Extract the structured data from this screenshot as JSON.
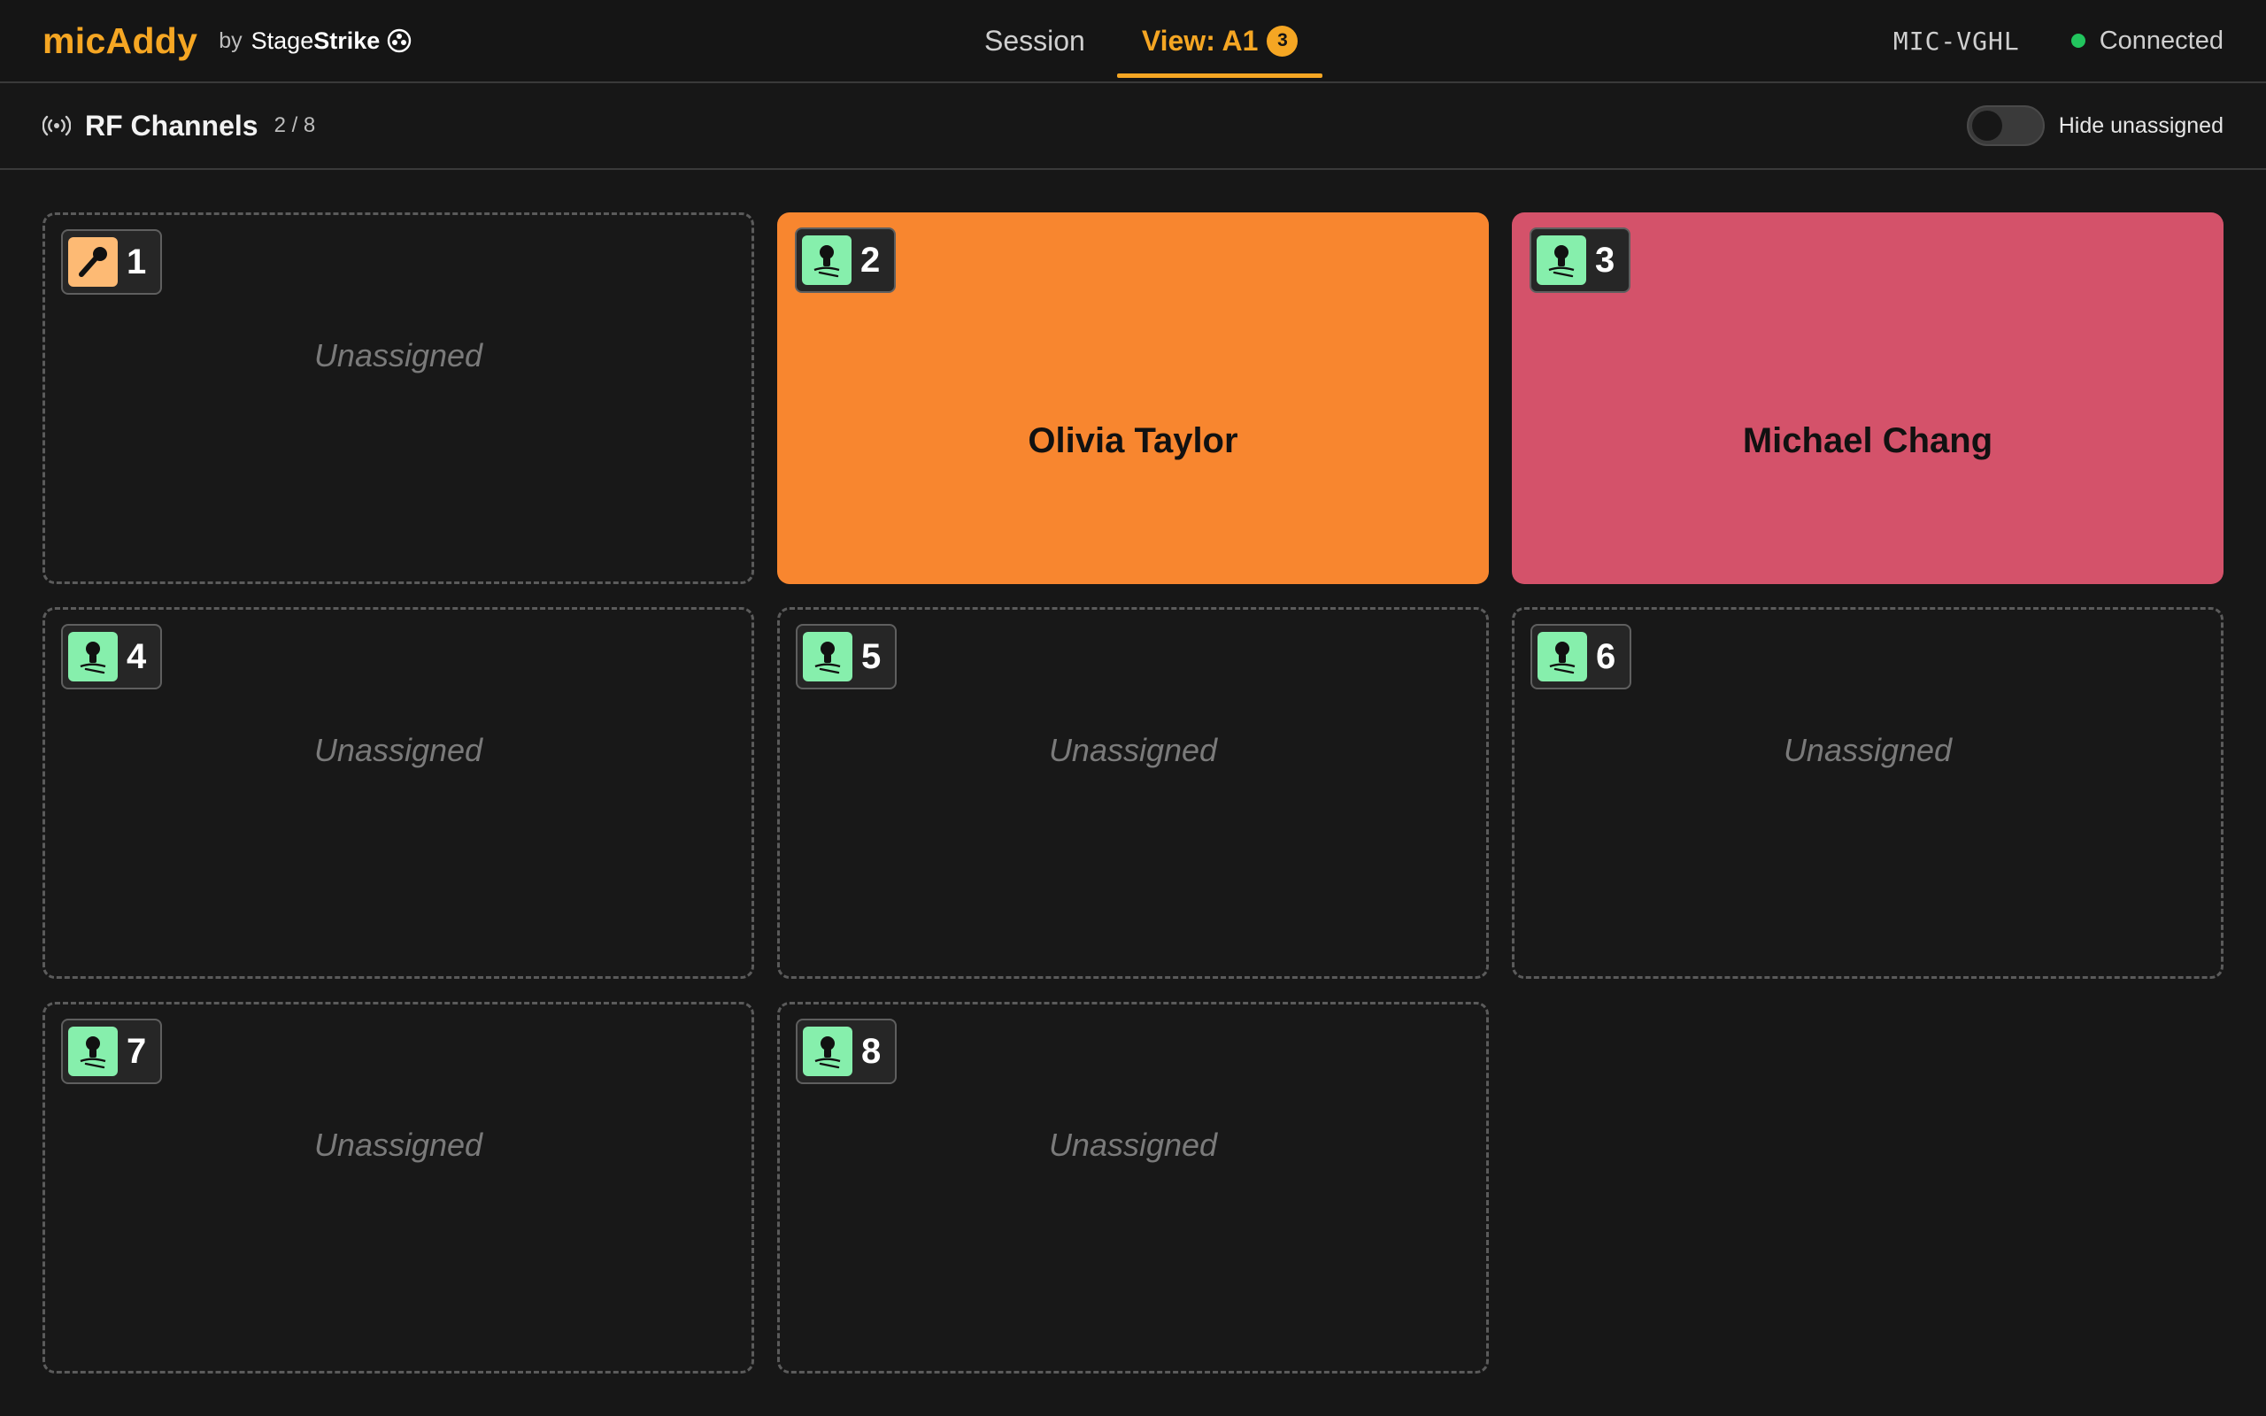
{
  "app": {
    "name": "micAddy",
    "by": "by",
    "company_light": "Stage",
    "company_bold": "Strike"
  },
  "nav": {
    "tabs": [
      {
        "label": "Session"
      },
      {
        "label": "View: A1",
        "badge": "3",
        "active": true
      }
    ]
  },
  "status": {
    "device_id": "MIC-VGHL",
    "connection": "Connected",
    "connection_color": "#22c55e"
  },
  "subheader": {
    "title": "RF Channels",
    "count": "2 / 8",
    "toggle_label": "Hide unassigned",
    "toggle_on": false
  },
  "colors": {
    "accent": "#f5a623",
    "lavalier_icon_bg": "#86efac",
    "handheld_icon_bg": "#fdba74"
  },
  "channels": [
    {
      "number": "1",
      "mic": "handheld-mic-icon",
      "assigned": false,
      "label": "Unassigned"
    },
    {
      "number": "2",
      "mic": "lavalier-mic-icon",
      "assigned": true,
      "name": "Olivia Taylor",
      "color": "#f8862f"
    },
    {
      "number": "3",
      "mic": "lavalier-mic-icon",
      "assigned": true,
      "name": "Michael Chang",
      "color": "#d4526a"
    },
    {
      "number": "4",
      "mic": "lavalier-mic-icon",
      "assigned": false,
      "label": "Unassigned"
    },
    {
      "number": "5",
      "mic": "lavalier-mic-icon",
      "assigned": false,
      "label": "Unassigned"
    },
    {
      "number": "6",
      "mic": "lavalier-mic-icon",
      "assigned": false,
      "label": "Unassigned"
    },
    {
      "number": "7",
      "mic": "lavalier-mic-icon",
      "assigned": false,
      "label": "Unassigned"
    },
    {
      "number": "8",
      "mic": "lavalier-mic-icon",
      "assigned": false,
      "label": "Unassigned"
    }
  ]
}
